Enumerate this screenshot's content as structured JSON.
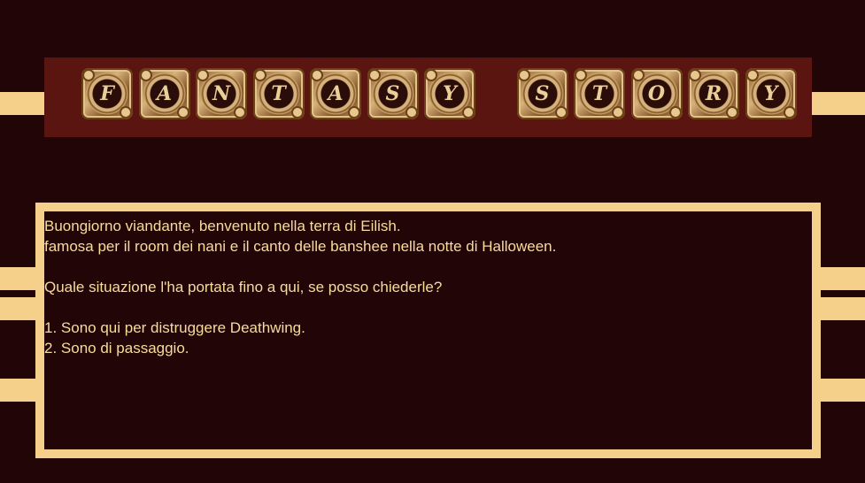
{
  "title": {
    "word1": [
      "F",
      "A",
      "N",
      "T",
      "A",
      "S",
      "Y"
    ],
    "word2": [
      "S",
      "T",
      "O",
      "R",
      "Y"
    ]
  },
  "dialog": {
    "line1": "Buongiorno viandante, benvenuto nella terra di Eilish.",
    "line2": "famosa per il room dei nani e il canto delle banshee nella notte di Halloween.",
    "line3": "Quale situazione l'ha portata fino a qui, se posso chiederle?",
    "choices": [
      "1. Sono qui per distruggere Deathwing.",
      "2. Sono di passaggio."
    ]
  },
  "colors": {
    "background": "#220507",
    "accent": "#f5d08a",
    "banner": "#5a1510",
    "text": "#f7dc9a"
  }
}
